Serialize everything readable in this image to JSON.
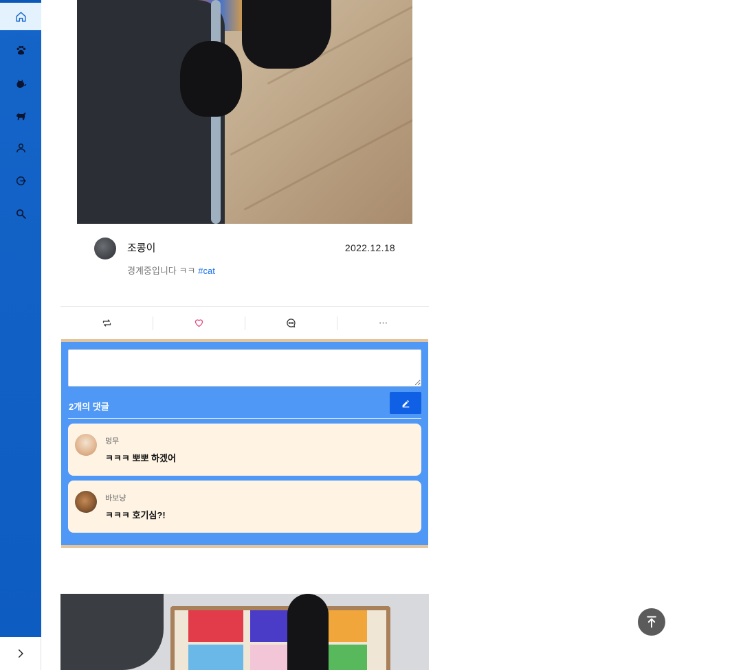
{
  "sidebar": {
    "items": [
      {
        "icon": "home-icon",
        "active": true
      },
      {
        "icon": "paw-icon",
        "active": false
      },
      {
        "icon": "cat-icon",
        "active": false
      },
      {
        "icon": "dog-icon",
        "active": false
      },
      {
        "icon": "user-icon",
        "active": false
      },
      {
        "icon": "logout-icon",
        "active": false
      },
      {
        "icon": "search-icon",
        "active": false
      }
    ],
    "expand_icon": "chevron-right-icon"
  },
  "post": {
    "author": "조콩이",
    "date": "2022.12.18",
    "caption": "경계중입니다 ㅋㅋ",
    "hashtag": "#cat",
    "actions": [
      "repost-icon",
      "heart-icon",
      "comment-icon",
      "more-icon"
    ]
  },
  "comments": {
    "input_value": "",
    "count_label": "2개의 댓글",
    "items": [
      {
        "author": "멍무",
        "text": "ㅋㅋㅋ 뽀뽀 하겠어"
      },
      {
        "author": "바보냥",
        "text": "ㅋㅋㅋ 호기심?!"
      }
    ]
  },
  "colors": {
    "sidebar": "#1565c9",
    "comments_bg": "#4f98f5",
    "comment_card": "#fff4e4",
    "hashtag": "#1a73e8",
    "heart": "#e8457a"
  },
  "scroll_top_icon": "arrow-up-to-line-icon"
}
